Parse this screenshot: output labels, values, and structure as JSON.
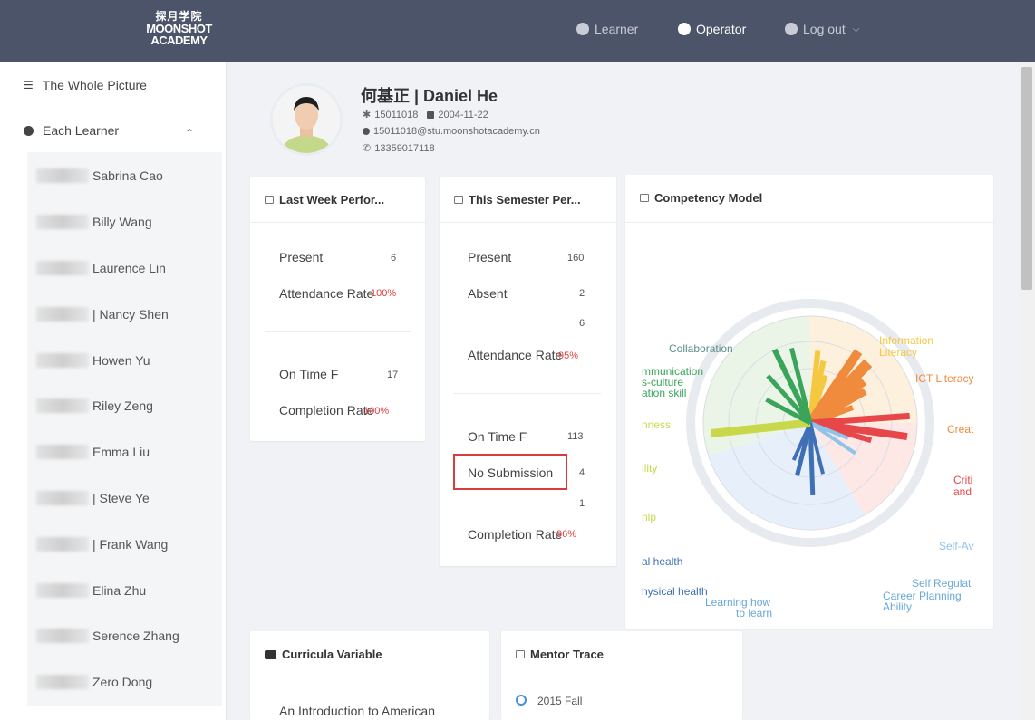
{
  "header": {
    "logo_cn": "探月学院",
    "logo_en_1": "MOONSHOT",
    "logo_en_2": "ACADEMY",
    "nav": {
      "learner": "Learner",
      "operator": "Operator",
      "logout": "Log out"
    }
  },
  "sidebar": {
    "whole_picture": "The Whole Picture",
    "each_learner": "Each Learner",
    "learners": [
      "Sabrina Cao",
      "Billy Wang",
      "Laurence Lin",
      "| Nancy Shen",
      "Howen Yu",
      "Riley Zeng",
      "Emma Liu",
      "| Steve Ye",
      "| Frank Wang",
      "Elina Zhu",
      "Serence Zhang",
      "Zero Dong"
    ]
  },
  "profile": {
    "name": "何基正 | Daniel He",
    "id": "15011018",
    "birthday": "2004-11-22",
    "email": "15011018@stu.moonshotacademy.cn",
    "phone": "13359017118"
  },
  "last_week": {
    "title": "Last Week Perfor...",
    "present_label": "Present",
    "present_value": "6",
    "attendance_label": "Attendance Rate",
    "attendance_value": "100%",
    "ontime_label": "On Time F",
    "ontime_value": "17",
    "completion_label": "Completion Rate",
    "completion_value": "100%"
  },
  "semester": {
    "title": "This Semester Per...",
    "present_label": "Present",
    "present_value": "160",
    "absent_label": "Absent",
    "absent_value": "2",
    "extra_value": "6",
    "attendance_label": "Attendance Rate",
    "attendance_value": "95%",
    "ontime_label": "On Time F",
    "ontime_value": "113",
    "nosub_label": "No Submission",
    "nosub_value": "4",
    "extra_value_2": "1",
    "completion_label": "Completion Rate",
    "completion_value": "96%"
  },
  "competency": {
    "title": "Competency Model",
    "labels": {
      "collaboration": "Collaboration",
      "information_literacy_1": "Information",
      "information_literacy_2": "Literacy",
      "ict_literacy": "ICT Literacy",
      "creat": "Creat",
      "crit_1": "Criti",
      "crit_2": "and",
      "self_aw": "Self-Av",
      "self_reg": "Self Regulat",
      "career_1": "Career Planning",
      "career_2": "Ability",
      "learning_1": "Learning how",
      "learning_2": "to learn",
      "physical": "hysical health",
      "mental": "al health",
      "communication_1": "mmunication",
      "communication_2": "s-culture",
      "communication_3": "ation skill",
      "ness": "nness",
      "ity": "ility",
      "lp": "nlp"
    },
    "colors": {
      "yellow": "#f5c842",
      "orange": "#f08a3c",
      "red": "#e8474a",
      "green": "#3aa55a",
      "lime": "#c8d84a",
      "blue": "#3f6fb5",
      "lightblue": "#8ec4ea"
    }
  },
  "curricula": {
    "title": "Curricula Variable",
    "item": "An Introduction to American"
  },
  "mentor": {
    "title": "Mentor Trace",
    "item": "2015 Fall"
  }
}
